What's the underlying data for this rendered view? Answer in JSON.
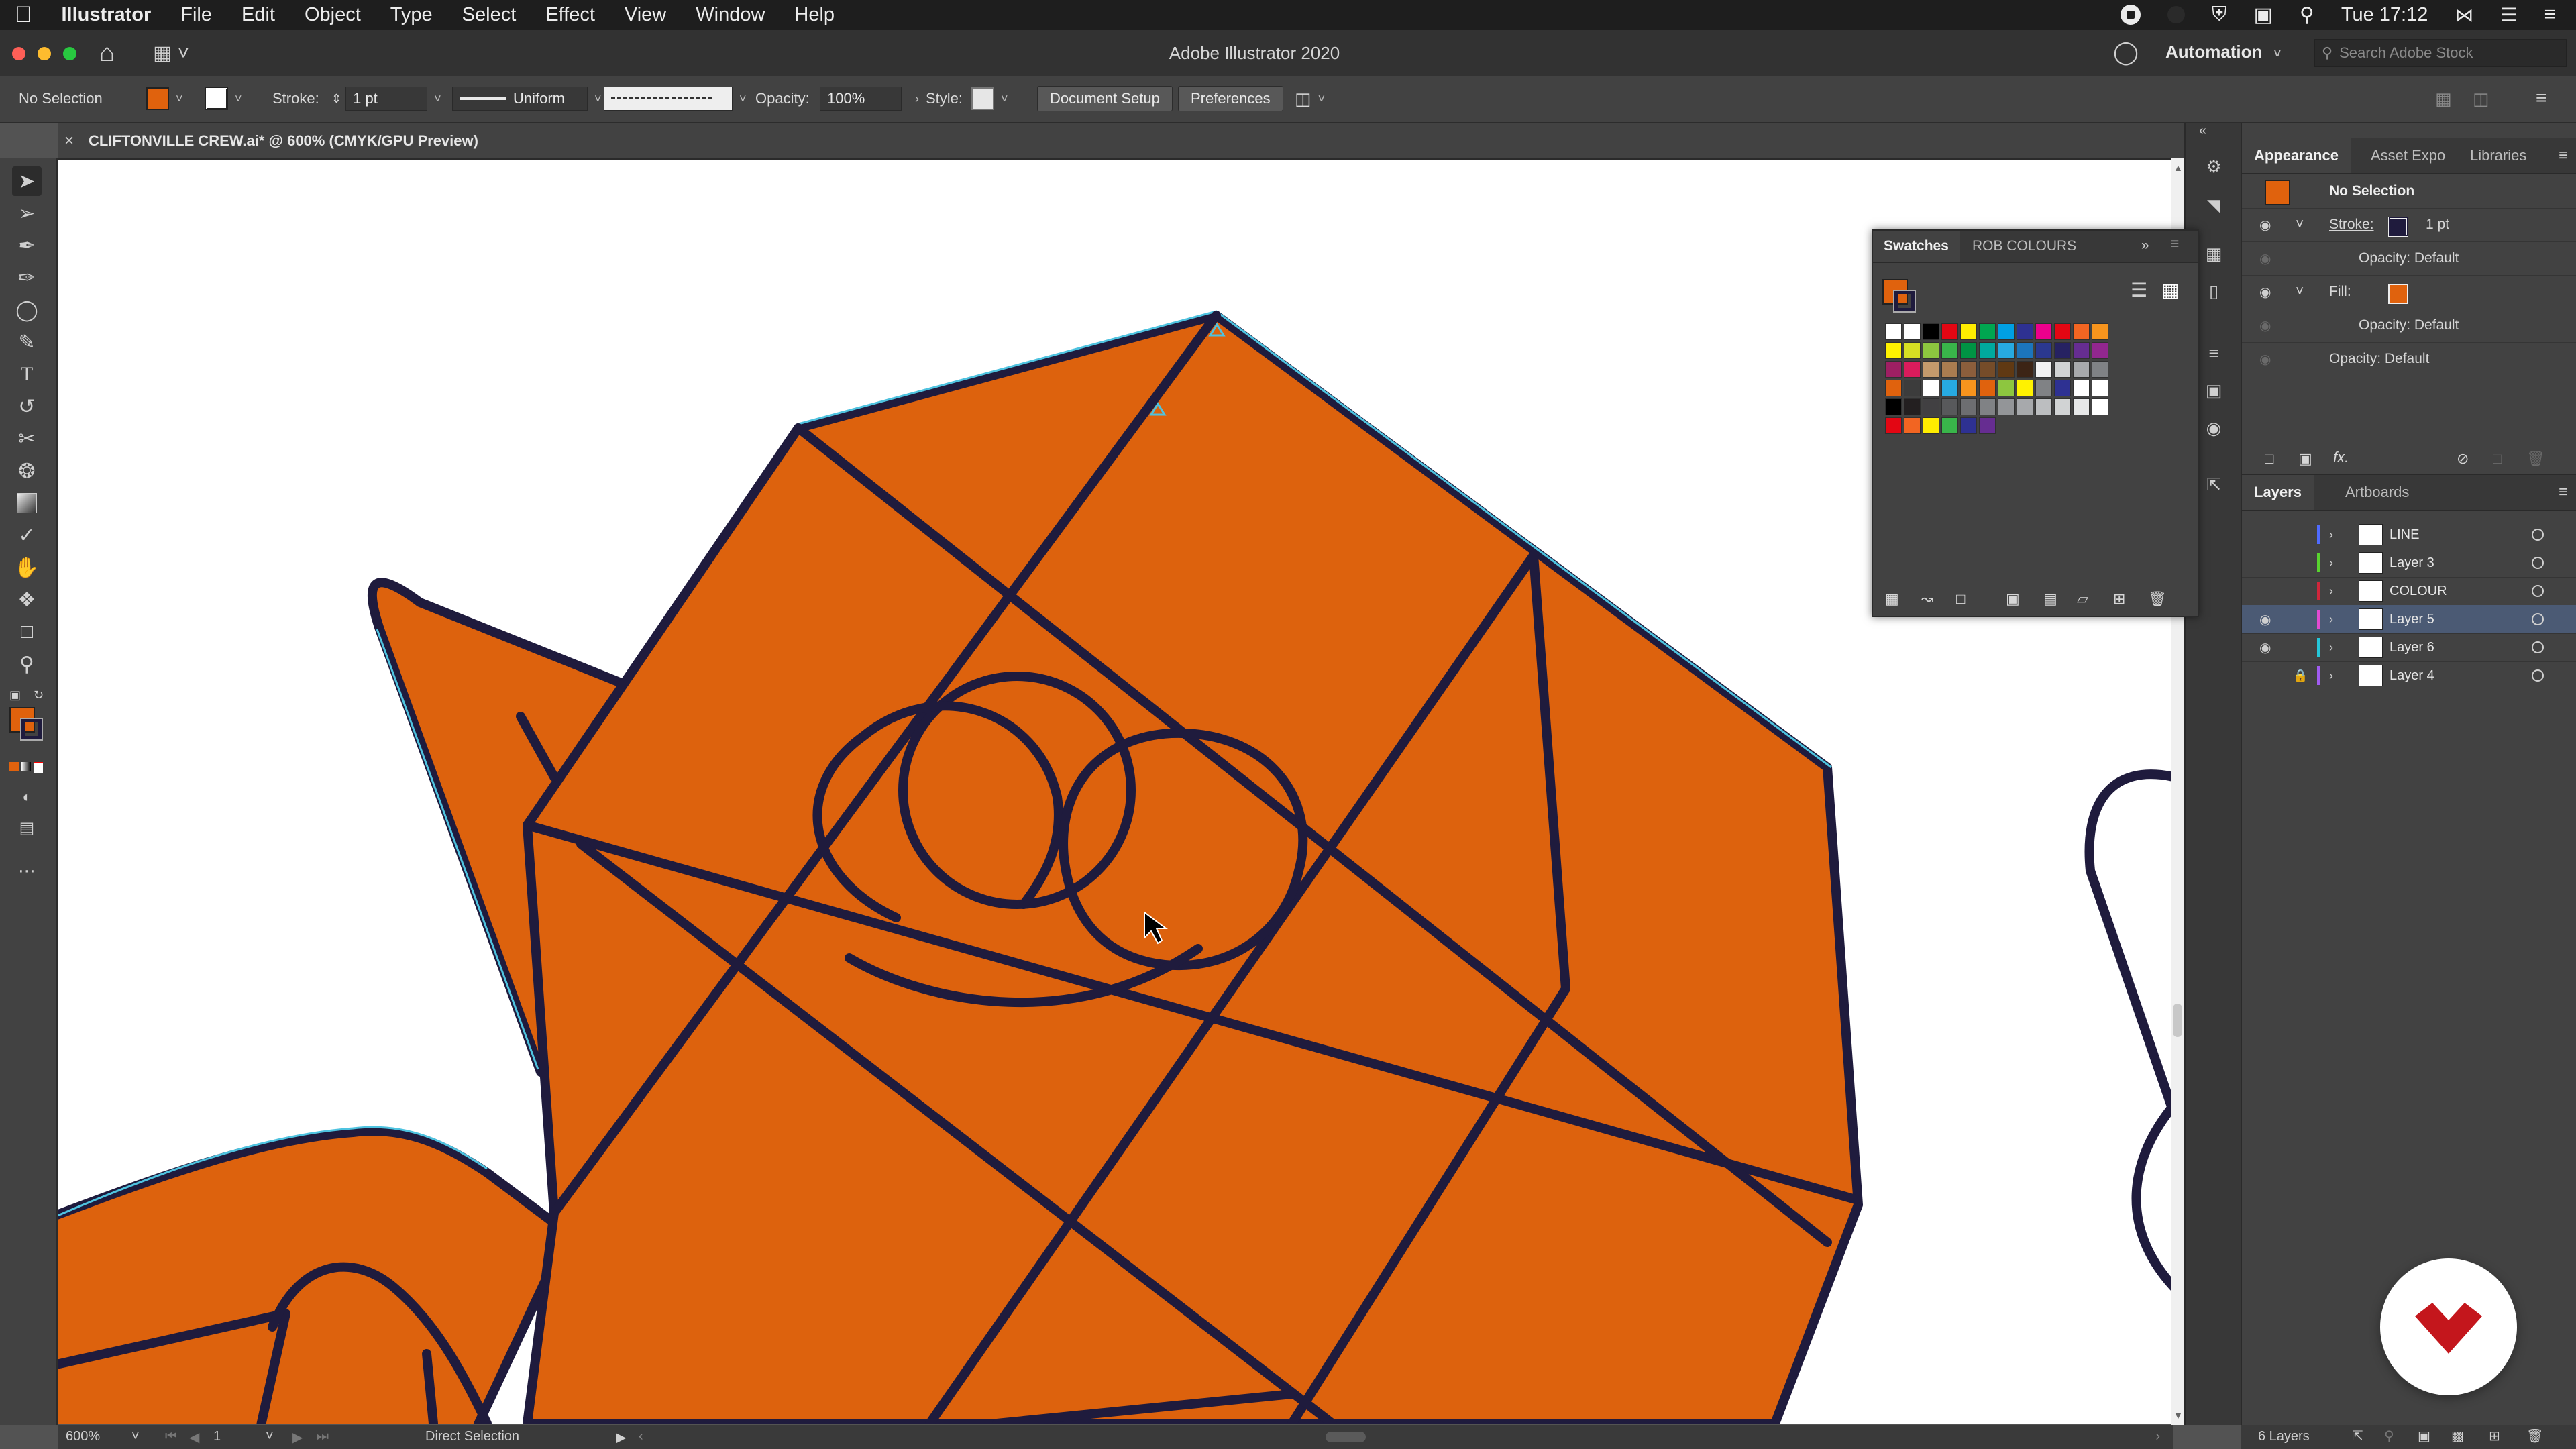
{
  "menubar": {
    "app_name": "Illustrator",
    "items": [
      "File",
      "Edit",
      "Object",
      "Type",
      "Select",
      "Effect",
      "View",
      "Window",
      "Help"
    ],
    "clock": "Tue 17:12"
  },
  "titlebar": {
    "title": "Adobe Illustrator 2020",
    "workspace": "Automation",
    "search_placeholder": "Search Adobe Stock"
  },
  "controlbar": {
    "selection": "No Selection",
    "stroke_label": "Stroke:",
    "stroke_weight": "1 pt",
    "profile": "Uniform",
    "opacity_label": "Opacity:",
    "opacity_value": "100%",
    "style_label": "Style:",
    "document_setup": "Document Setup",
    "preferences": "Preferences",
    "fill_color": "#e0620d"
  },
  "document": {
    "tab_title": "CLIFTONVILLE CREW.ai* @ 600% (CMYK/GPU Preview)"
  },
  "colors": {
    "art_fill": "#dd620d",
    "art_stroke": "#1f1b3d",
    "selection_outline": "#4ec3e0",
    "accent_red": "#d0021b"
  },
  "swatches": {
    "tabs": [
      "Swatches",
      "ROB COLOURS"
    ],
    "rows": [
      [
        "#ffffff",
        "#ffffff",
        "#000000",
        "#e30613",
        "#ffed00",
        "#00a650",
        "#00a0e3",
        "#2e3192",
        "#ec008c",
        "#e30613",
        "#f26522",
        "#f7941d"
      ],
      [
        "#fff200",
        "#d7df23",
        "#8dc63f",
        "#39b54a",
        "#009444",
        "#00a99d",
        "#27aae1",
        "#1c75bc",
        "#2b388f",
        "#262262",
        "#662d91",
        "#92278f"
      ],
      [
        "#9e1f63",
        "#da1c5c",
        "#c49a6c",
        "#a97c50",
        "#8b5e3c",
        "#754c29",
        "#603913",
        "#3c2415",
        "#f2f2f2",
        "#d1d3d4",
        "#a7a9ac",
        "#808285"
      ],
      [
        "#e0620d",
        "#3c3c3c",
        "#ffffff",
        "#27aae1",
        "#f7941d",
        "#e0620d",
        "#8dc63f",
        "#fff200",
        "#808285",
        "#2e3192",
        "#ffffff",
        "#ffffff"
      ],
      [
        "#000000",
        "#231f20",
        "#414042",
        "#58595b",
        "#6d6e71",
        "#808285",
        "#939598",
        "#a7a9ac",
        "#bcbec0",
        "#d1d3d4",
        "#e6e7e8",
        "#ffffff"
      ],
      [
        "#e30613",
        "#f26522",
        "#ffed00",
        "#39b54a",
        "#2e3192",
        "#662d91"
      ]
    ]
  },
  "appearance": {
    "tabs": [
      "Appearance",
      "Asset Expo",
      "Libraries"
    ],
    "header": "No Selection",
    "stroke_label": "Stroke:",
    "stroke_value": "1 pt",
    "opacity_line": "Opacity: Default",
    "fill_label": "Fill:",
    "opacity_line2": "Opacity: Default",
    "opacity_line3": "Opacity: Default"
  },
  "layers": {
    "tabs": [
      "Layers",
      "Artboards"
    ],
    "items": [
      {
        "name": "LINE",
        "color": "#4f6bff"
      },
      {
        "name": "Layer 3",
        "color": "#58d32f"
      },
      {
        "name": "COLOUR",
        "color": "#d0263b"
      },
      {
        "name": "Layer 5",
        "color": "#e24bd0"
      },
      {
        "name": "Layer 6",
        "color": "#25c6d9"
      },
      {
        "name": "Layer 4",
        "color": "#a05bf0"
      }
    ],
    "count": "6 Layers"
  },
  "statusbar": {
    "zoom": "600%",
    "artboard": "1",
    "tool": "Direct Selection"
  }
}
